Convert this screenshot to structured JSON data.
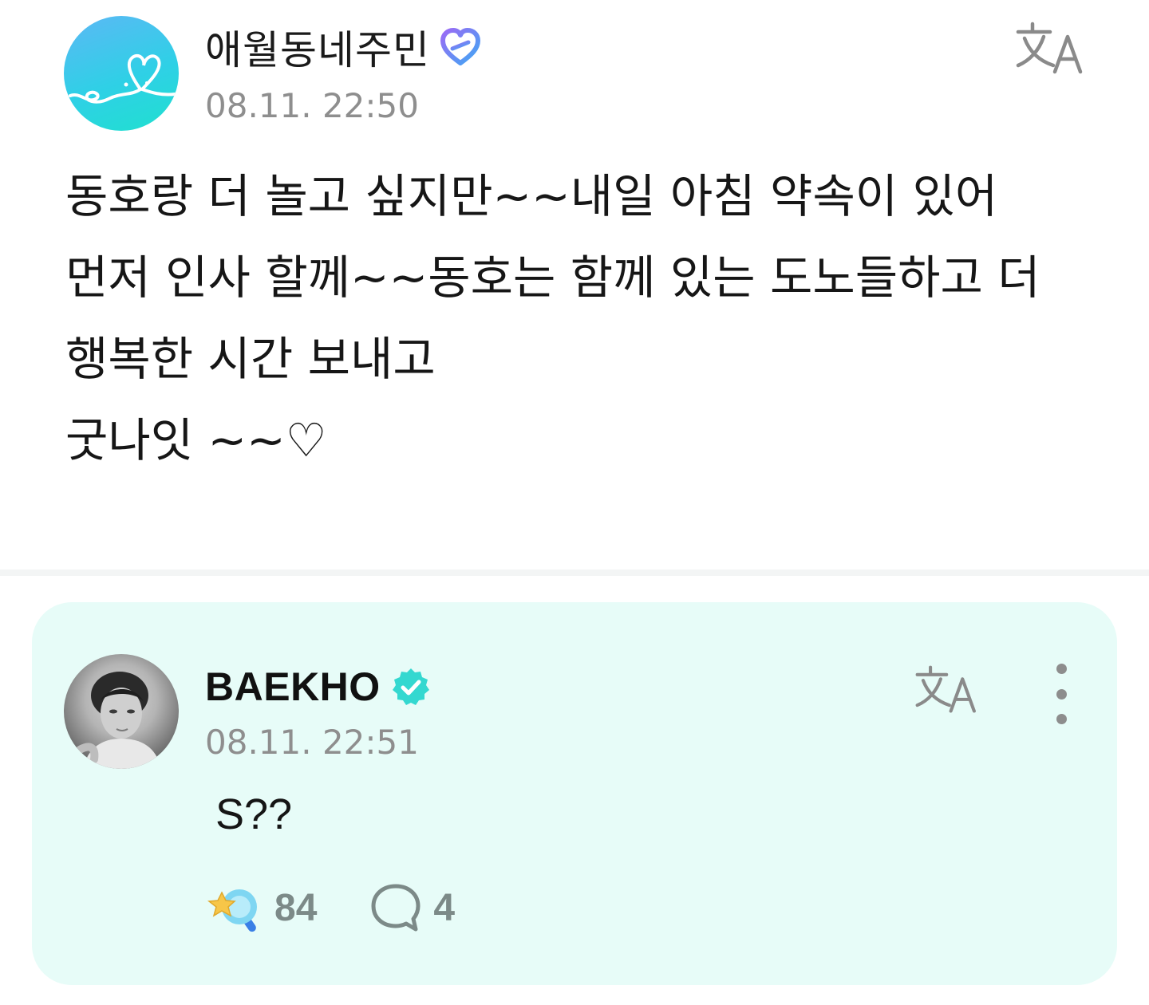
{
  "post": {
    "author": "애월동네주민",
    "time": "08.11. 22:50",
    "lines": [
      "동호랑 더 놀고 싶지만~~내일 아침 약속이 있어",
      "먼저 인사 할께~~동호는 함께 있는 도노들하고 더",
      "행복한 시간 보내고",
      "굿나잇 ~~♡"
    ]
  },
  "reply": {
    "author": "BAEKHO",
    "time": "08.11. 22:51",
    "text": "S??",
    "like_count": "84",
    "comment_count": "4"
  },
  "colors": {
    "card_background": "#e7fcf8",
    "verified_badge": "#34d8d0",
    "secondary_text": "#8e8e8e"
  },
  "icons": {
    "fan_badge": "heart-badge-icon",
    "verified": "verified-check-icon",
    "translate": "translate-icon",
    "more": "more-vertical-icon",
    "like": "star-lollipop-icon",
    "comment": "comment-bubble-icon"
  }
}
